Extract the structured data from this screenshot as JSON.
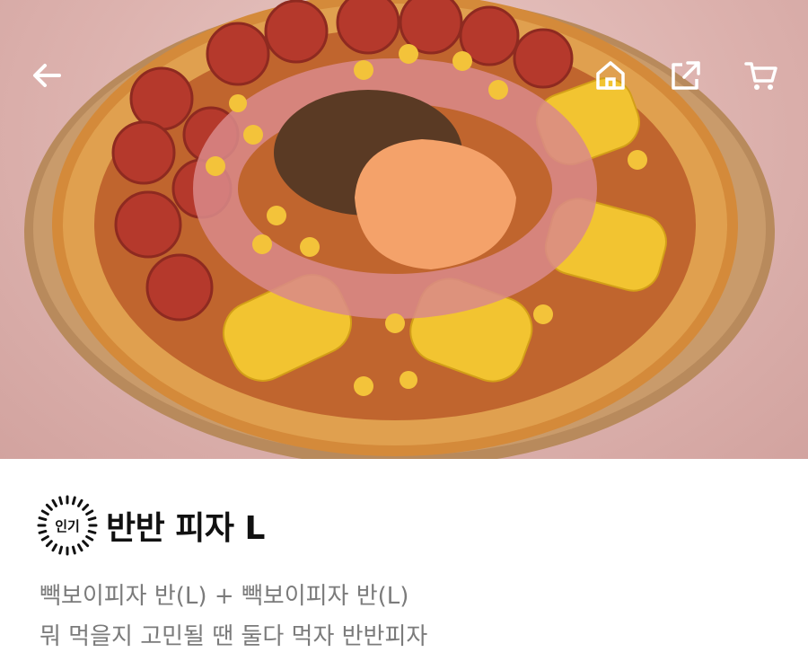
{
  "header": {
    "back_icon": "arrow-left-icon",
    "home_icon": "home-icon",
    "share_icon": "share-icon",
    "cart_icon": "cart-icon"
  },
  "hero": {
    "image": "pizza-photo"
  },
  "product": {
    "badge_text": "인기",
    "title": "반반 피자 L",
    "description_line1": "빽보이피자 반(L) + 빽보이피자 반(L)",
    "description_line2": "뭐 먹을지 고민될 땐 둘다 먹자 반반피자"
  },
  "colors": {
    "title": "#111111",
    "description": "#7b7b7b",
    "icon": "#ffffff"
  }
}
